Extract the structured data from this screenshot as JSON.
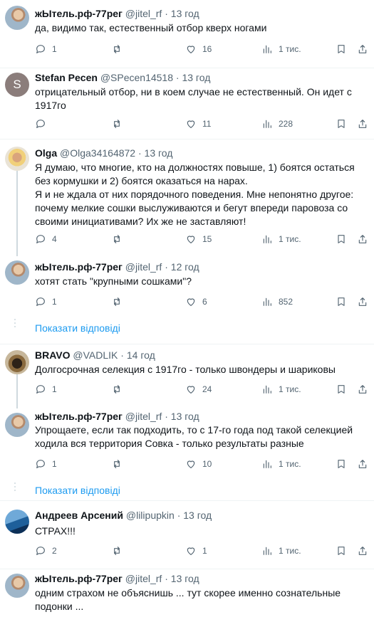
{
  "tweets": [
    {
      "name": "жЫтель.рф-77рег",
      "handle": "@jitel_rf",
      "time": "13 год",
      "text": "да, видимо так, естественный отбор кверх ногами",
      "replies": "1",
      "likes": "16",
      "views": "1 тис."
    },
    {
      "name": "Stefan Pecen",
      "handle": "@SPecen14518",
      "time": "13 год",
      "initial": "S",
      "text": "отрицательный отбор, ни в коем случае не естественный. Он идет с 1917го",
      "replies": "",
      "likes": "11",
      "views": "228"
    },
    {
      "name": "Olga",
      "handle": "@Olga34164872",
      "time": "13 год",
      "text": "Я думаю, что многие, кто на должностях повыше, 1) боятся остаться без кормушки и 2) боятся оказаться на нарах.\nЯ и не ждала от них порядочного поведения. Мне непонятно другое: почему мелкие сошки выслуживаются и бегут впереди паровоза со своими инициативами? Их же не заставляют!",
      "replies": "4",
      "likes": "15",
      "views": "1 тис."
    },
    {
      "name": "жЫтель.рф-77рег",
      "handle": "@jitel_rf",
      "time": "12 год",
      "text": "хотят стать \"крупными сошками\"?",
      "replies": "1",
      "likes": "6",
      "views": "852"
    },
    {
      "name": "BRAVO",
      "handle": "@VADLIK",
      "time": "14 год",
      "text": "Долгосрочная селекция с 1917го - только швондеры и шариковы",
      "replies": "1",
      "likes": "24",
      "views": "1 тис."
    },
    {
      "name": "жЫтель.рф-77рег",
      "handle": "@jitel_rf",
      "time": "13 год",
      "text": "Упрощаете, если так подходить, то с 17-го года под такой селекцией ходила вся территория Совка - только результаты разные",
      "replies": "1",
      "likes": "10",
      "views": "1 тис."
    },
    {
      "name": "Андреев Арсений",
      "handle": "@lilipupkin",
      "time": "13 год",
      "text": "СТРАХ!!!",
      "replies": "2",
      "likes": "1",
      "views": "1 тис."
    },
    {
      "name": "жЫтель.рф-77рег",
      "handle": "@jitel_rf",
      "time": "13 год",
      "text": "одним страхом не объяснишь ... тут скорее именно сознательные подонки ..."
    }
  ],
  "show_replies_label": "Показати відповіді",
  "separator": "·",
  "icons": {
    "reply": "reply-icon",
    "retweet": "retweet-icon",
    "like": "like-icon",
    "views": "views-icon",
    "bookmark": "bookmark-icon",
    "share": "share-icon"
  },
  "colors": {
    "link": "#1d9bf0",
    "muted": "#536471",
    "divider": "#eff3f4",
    "thread": "#cfd9de"
  }
}
